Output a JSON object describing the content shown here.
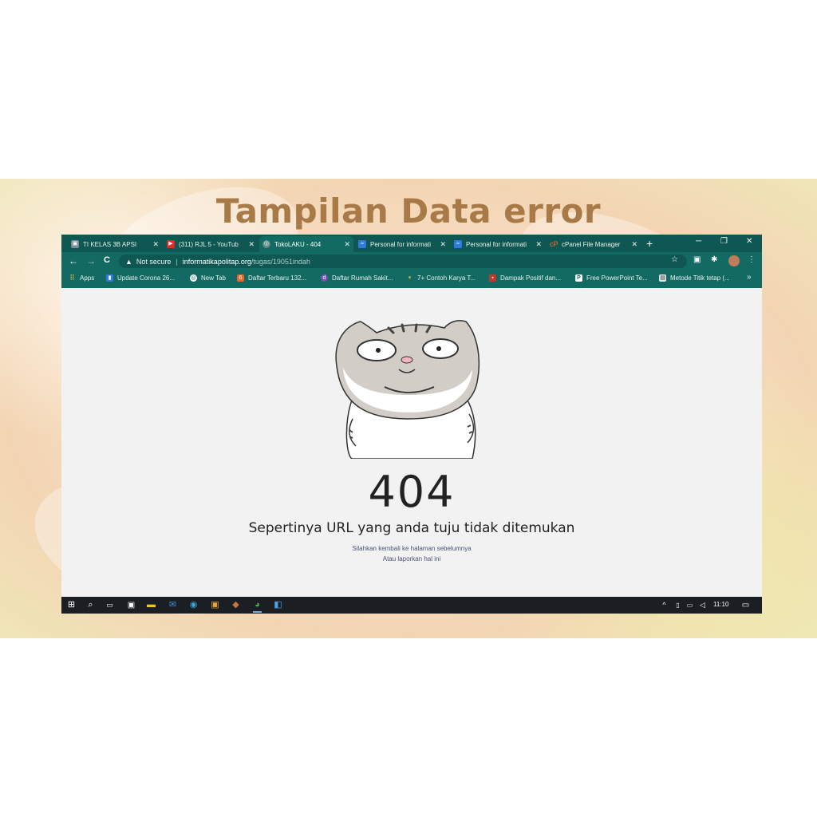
{
  "slide": {
    "title": "Tampilan Data error"
  },
  "browser": {
    "tabs": [
      {
        "label": "TI KELAS 3B APSI",
        "icon": "classroom-icon",
        "active": false
      },
      {
        "label": "(311) RJL 5 - YouTub",
        "icon": "youtube-icon",
        "active": false
      },
      {
        "label": "TokoLAKU - 404",
        "icon": "globe-icon",
        "active": true
      },
      {
        "label": "Personal for informati",
        "icon": "chart-icon",
        "active": false
      },
      {
        "label": "Personal for informati",
        "icon": "chart-icon",
        "active": false
      },
      {
        "label": "cPanel File Manager",
        "icon": "cpanel-icon",
        "active": false
      }
    ],
    "new_tab": "+",
    "window_controls": {
      "minimize": "─",
      "restore": "❐",
      "close": "✕"
    },
    "nav": {
      "back": "←",
      "forward": "→",
      "reload": "C"
    },
    "address": {
      "warning_icon": "▲",
      "security": "Not secure",
      "separator": "|",
      "domain": "informatikapolitap.org",
      "path": "/tugas/19051indah"
    },
    "toolbar_icons": {
      "star": "☆",
      "extension": "▣",
      "puzzle": "✱",
      "menu": "⋮"
    },
    "bookmarks": [
      {
        "label": "Apps",
        "icon": "apps-grid-icon"
      },
      {
        "label": "Update Corona 26...",
        "icon": "bookmark-icon"
      },
      {
        "label": "New Tab",
        "icon": "globe-icon"
      },
      {
        "label": "Daftar Terbaru 132...",
        "icon": "fire-icon"
      },
      {
        "label": "Daftar Rumah Sakit...",
        "icon": "site-icon"
      },
      {
        "label": "7+ Contoh Karya T...",
        "icon": "arrow-icon"
      },
      {
        "label": "Dampak Positif dan...",
        "icon": "gift-icon"
      },
      {
        "label": "Free PowerPoint Te...",
        "icon": "powerpoint-icon"
      },
      {
        "label": "Metode Titik tetap (...",
        "icon": "doc-icon"
      }
    ],
    "bookmarks_more": "»"
  },
  "page": {
    "code": "404",
    "message": "Sepertinya URL yang anda tuju tidak ditemukan",
    "sub1": "Silahkan kembali ke halaman sebelumnya",
    "sub2": "Atau laporkan hal ini"
  },
  "taskbar": {
    "start": "⊞",
    "search": "⌕",
    "clock": "11:10",
    "tray": {
      "chevron": "^",
      "notification": "▭"
    }
  },
  "colors": {
    "chrome_dark": "#0f5752",
    "chrome": "#136a63",
    "title": "#a77a47",
    "taskbar": "#1b1e23"
  }
}
